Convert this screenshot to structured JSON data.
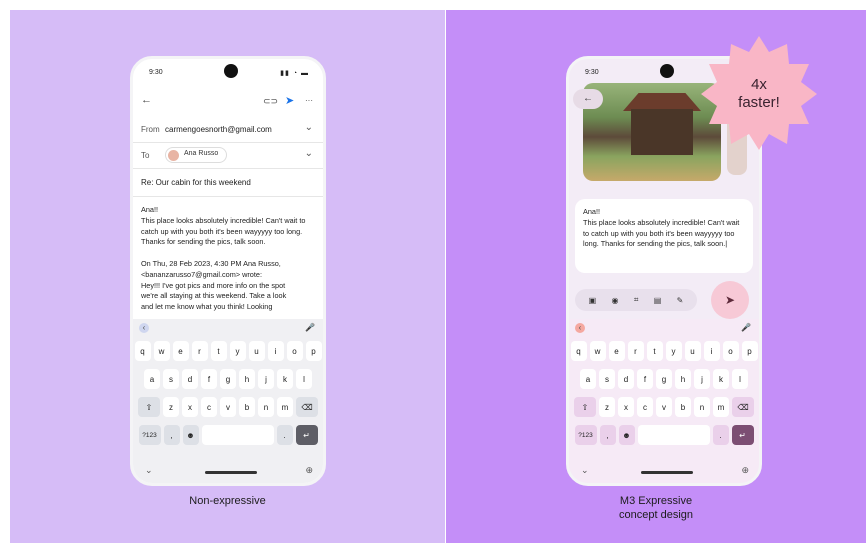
{
  "left_panel": {
    "caption": "Non-expressive",
    "phone": {
      "time": "9:30",
      "status_icons": "▮▮ ◔ ▬",
      "toolbar": {
        "back": "←",
        "attach": "⊂⊃",
        "send": "➤",
        "more": "···"
      },
      "from_label": "From",
      "from_value": "carmengoesnorth@gmail.com",
      "to_label": "To",
      "to_value": "Ana Russo",
      "subject": "Re: Our cabin for this weekend",
      "body": "Ana!!\nThis place looks absolutely incredible! Can't wait to catch up with you both it's been wayyyyy too long. Thanks for sending the pics, talk soon.\n\nOn Thu, 28 Feb 2023, 4:30 PM Ana Russo, <bananzarusso7@gmail.com> wrote:\n  Hey!!! I've got pics and more info on the spot\n  we're all staying at this weekend. Take a look\n  and let me know what you think! Looking"
    }
  },
  "right_panel": {
    "caption_line1": "M3 Expressive",
    "caption_line2": "concept design",
    "badge_line1": "4x",
    "badge_line2": "faster!",
    "phone": {
      "time": "9:30",
      "status_icons": "▮▮ ◔ ▬",
      "back": "←",
      "body": "Ana!!\nThis place looks absolutely incredible! Can't wait to catch up with you both it's been wayyyyy too long. Thanks for sending the pics, talk soon.|",
      "format_icons": [
        "▣",
        "◉",
        "⌗",
        "▤",
        "✎"
      ],
      "send": "➤"
    }
  },
  "keyboard": {
    "collapse": "‹",
    "mic": "🎤",
    "row1": [
      "q",
      "w",
      "e",
      "r",
      "t",
      "y",
      "u",
      "i",
      "o",
      "p"
    ],
    "row2": [
      "a",
      "s",
      "d",
      "f",
      "g",
      "h",
      "j",
      "k",
      "l"
    ],
    "row3": [
      "⇧",
      "z",
      "x",
      "c",
      "v",
      "b",
      "n",
      "m",
      "⌫"
    ],
    "row4": [
      "?123",
      ",",
      "☻",
      "",
      ".",
      "↵"
    ],
    "nav_down": "⌄",
    "nav_globe": "⊕"
  },
  "colors": {
    "left_bg": "#d6bcf7",
    "right_bg": "#c48ef8",
    "badge": "#f9b6c6"
  }
}
